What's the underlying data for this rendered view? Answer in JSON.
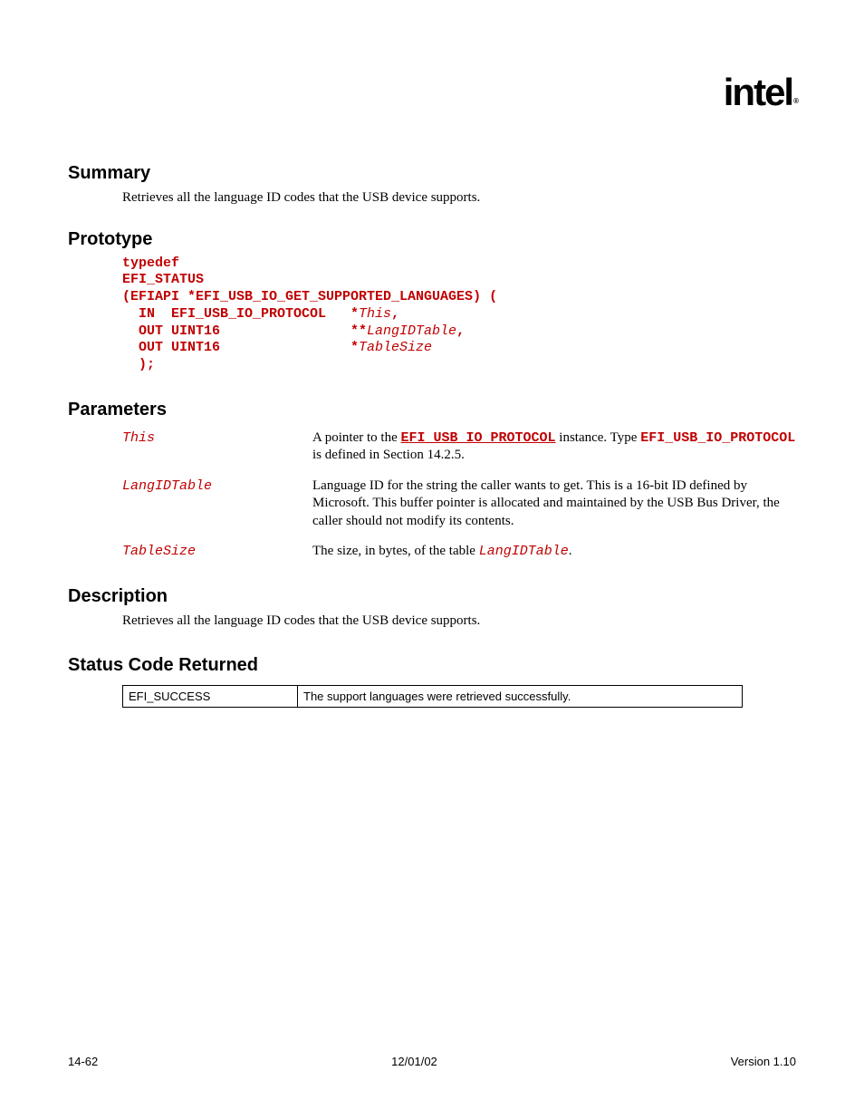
{
  "header": {
    "logo_text": "intel"
  },
  "sections": {
    "summary": {
      "label": "Summary",
      "text": "Retrieves all the language ID codes that the USB device supports."
    },
    "prototype": {
      "label": "Prototype",
      "l1": "typedef",
      "l2": "EFI_STATUS",
      "l3a": "(EFIAPI *EFI_USB_IO_GET_SUPPORTED_LANGUAGES) (",
      "l4a": "  IN  EFI_USB_IO_PROTOCOL   *",
      "l4b": "This",
      "l4c": ",",
      "l5a": "  OUT UINT16                **",
      "l5b": "LangIDTable",
      "l5c": ",",
      "l6a": "  OUT UINT16                *",
      "l6b": "TableSize",
      "l7": "  );"
    },
    "parameters": {
      "label": "Parameters",
      "items": [
        {
          "name": "This",
          "d1": "A pointer to the ",
          "code1": "EFI_USB_IO_PROTOCOL",
          "d2": " instance.  Type ",
          "code2": "EFI_USB_IO_PROTOCOL",
          "d3": " is defined in Section 14.2.5."
        },
        {
          "name": "LangIDTable",
          "d1": "Language ID for the string the caller wants to get.  This is a 16-bit ID defined by Microsoft.  This buffer pointer is allocated and maintained by the USB Bus Driver, the caller should not modify its contents."
        },
        {
          "name": "TableSize",
          "d1": "The size, in bytes, of the table ",
          "code1": "LangIDTable",
          "d2": "."
        }
      ]
    },
    "description": {
      "label": "Description",
      "text": "Retrieves all the language ID codes that the USB device supports."
    },
    "status": {
      "label": "Status Code Returned",
      "rows": [
        {
          "code": "EFI_SUCCESS",
          "meaning": "The support languages were retrieved successfully."
        }
      ]
    }
  },
  "footer": {
    "left": "14-62",
    "center": "12/01/02",
    "right": "Version 1.10"
  }
}
